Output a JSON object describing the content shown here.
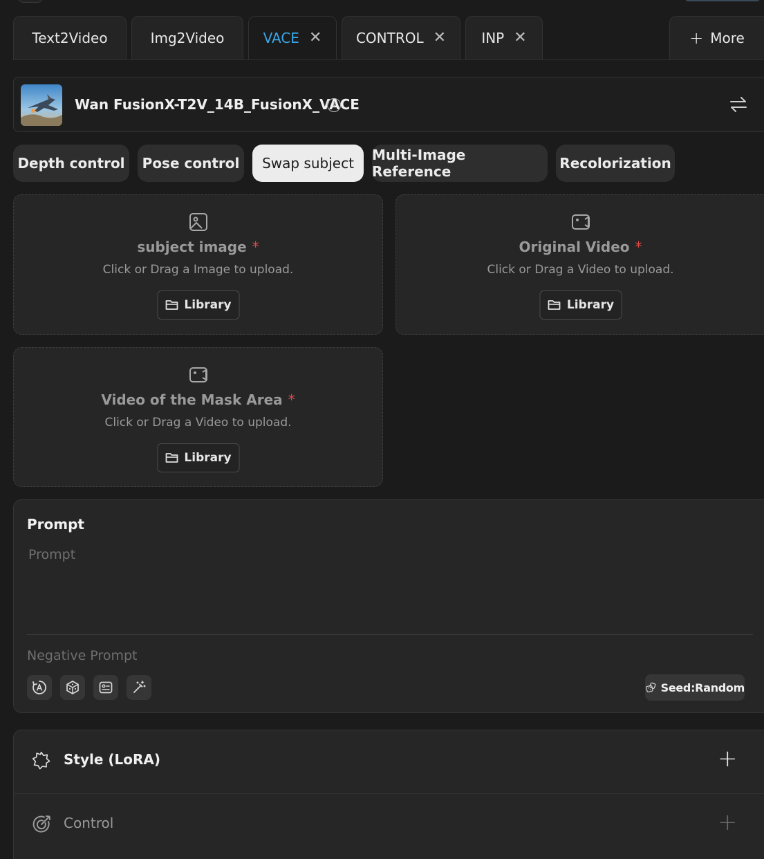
{
  "tabs": [
    {
      "label": "Text2Video",
      "closable": false
    },
    {
      "label": "Img2Video",
      "closable": false
    },
    {
      "label": "VACE",
      "closable": true,
      "active": true
    },
    {
      "label": "CONTROL",
      "closable": true
    },
    {
      "label": "INP",
      "closable": true
    }
  ],
  "tab_more_label": "More",
  "close_glyph": "✕",
  "model": {
    "name": "Wan FusionX-T2V_14B_FusionX_VACE",
    "info_glyph": "i"
  },
  "control_modes": [
    {
      "label": "Depth control"
    },
    {
      "label": "Pose control"
    },
    {
      "label": "Swap subject",
      "active": true
    },
    {
      "label": "Multi-Image Reference"
    },
    {
      "label": "Recolorization"
    }
  ],
  "uploads": {
    "subject": {
      "title": "subject image",
      "required_mark": "*",
      "hint": "Click or Drag a Image to upload.",
      "button": "Library"
    },
    "original": {
      "title": "Original Video",
      "required_mark": "*",
      "hint": "Click or Drag a Video to upload.",
      "button": "Library"
    },
    "mask": {
      "title": "Video of the Mask Area",
      "required_mark": "*",
      "hint": "Click or Drag a Video to upload.",
      "button": "Library"
    }
  },
  "prompt": {
    "title": "Prompt",
    "placeholder": "Prompt",
    "negative_placeholder": "Negative Prompt",
    "seed_label": "Seed:Random"
  },
  "sections": {
    "style_label": "Style (LoRA)",
    "control_label": "Control",
    "plus_glyph": "+"
  },
  "colors": {
    "accent_active_tab": "#3aa7e8",
    "required": "#e24a4a",
    "background": "#1b1b1b",
    "panel": "#262626"
  },
  "icons": [
    "close-icon",
    "plus-icon",
    "info-icon",
    "swap-arrows-icon",
    "image-icon",
    "video-icon",
    "folder-icon",
    "translate-icon",
    "dice-icon",
    "image-card-icon",
    "magic-wand-icon",
    "seed-dice-icon",
    "badge-icon",
    "target-icon"
  ]
}
